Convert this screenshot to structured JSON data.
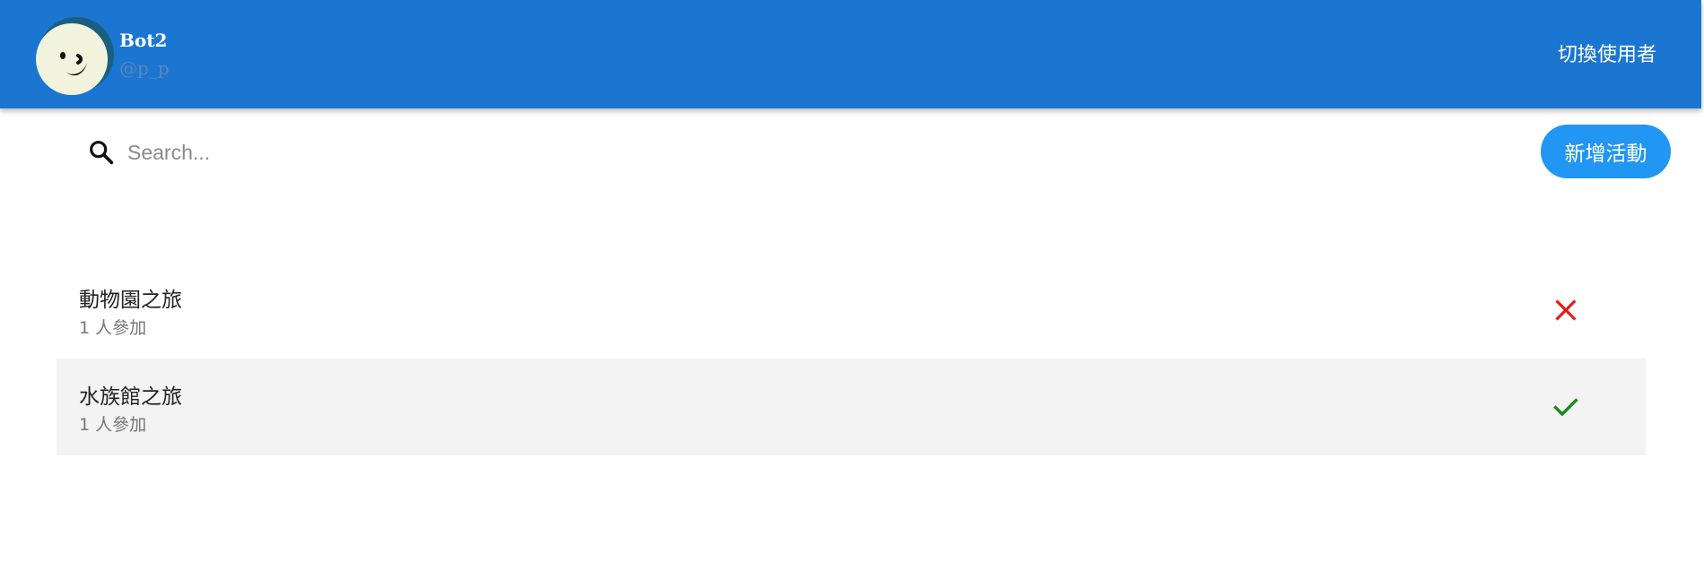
{
  "header": {
    "user_name": "Bot2",
    "user_handle": "@p_p",
    "switch_user_label": "切換使用者"
  },
  "toolbar": {
    "search_placeholder": "Search...",
    "search_value": "",
    "add_activity_label": "新增活動"
  },
  "activities": [
    {
      "title": "動物園之旅",
      "participants": "1 人參加",
      "status_icon": "close-icon",
      "status_color": "#e31c1c"
    },
    {
      "title": "水族館之旅",
      "participants": "1 人參加",
      "status_icon": "check-icon",
      "status_color": "#1b8a1b"
    }
  ],
  "colors": {
    "header_bg": "#1b76d2",
    "button_bg": "#2196f3",
    "alt_row_bg": "#f3f3f3"
  }
}
